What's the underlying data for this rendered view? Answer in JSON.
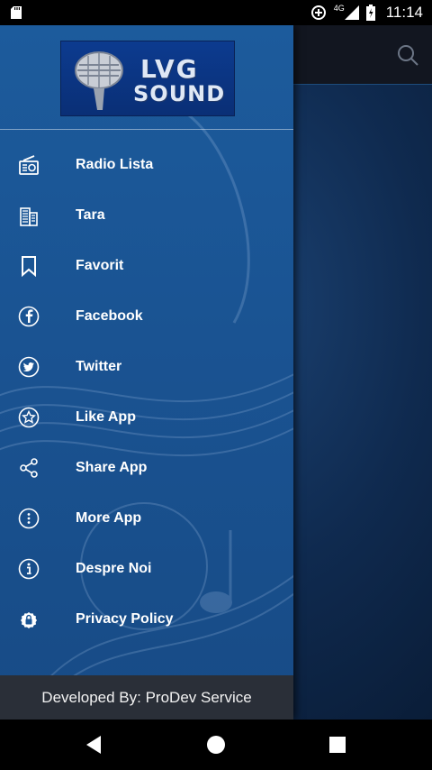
{
  "status": {
    "time": "11:14",
    "network": "4G"
  },
  "logo": {
    "line1": "LVG",
    "line2": "SOUND"
  },
  "app_bar": {
    "search_icon": "search-icon"
  },
  "menu": [
    {
      "label": "Radio Lista",
      "icon": "radio-icon"
    },
    {
      "label": "Tara",
      "icon": "building-icon"
    },
    {
      "label": "Favorit",
      "icon": "bookmark-icon"
    },
    {
      "label": "Facebook",
      "icon": "facebook-icon"
    },
    {
      "label": "Twitter",
      "icon": "twitter-icon"
    },
    {
      "label": "Like App",
      "icon": "star-icon"
    },
    {
      "label": "Share App",
      "icon": "share-icon"
    },
    {
      "label": "More App",
      "icon": "more-icon"
    },
    {
      "label": "Despre Noi",
      "icon": "info-icon"
    },
    {
      "label": "Privacy Policy",
      "icon": "lock-icon"
    }
  ],
  "footer": {
    "text": "Developed By: ProDev Service"
  },
  "colors": {
    "drawer": "#1c5b9c",
    "footer": "#2a2f38",
    "app_bar": "#121620"
  }
}
